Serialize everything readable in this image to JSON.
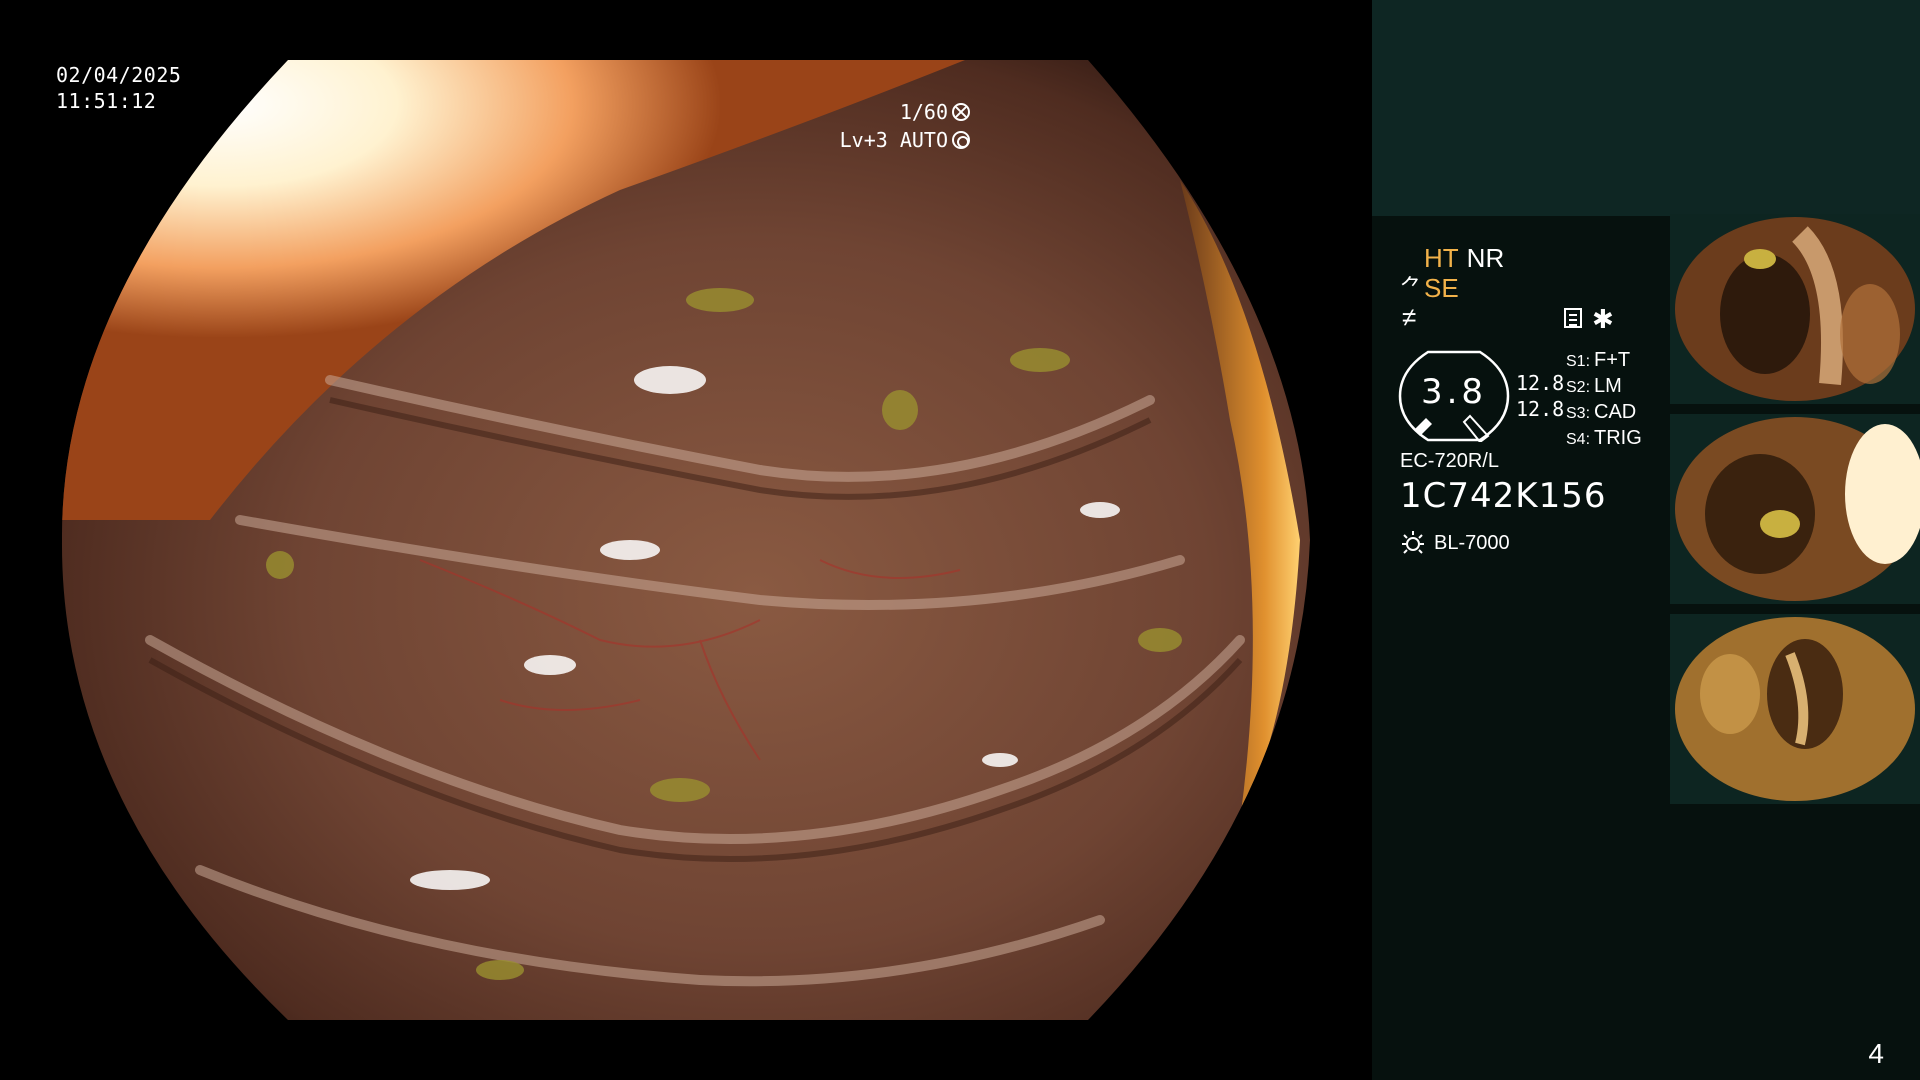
{
  "overlay": {
    "date": "02/04/2025",
    "time": "11:51:12",
    "shutter": "1/60",
    "iris": "Lv+3 AUTO"
  },
  "panel": {
    "ht": "HT",
    "nr": "NR",
    "se": "SE",
    "gauge_value": "3.8",
    "gauge_side_top": "12.8",
    "gauge_side_bottom": "12.8",
    "switches": [
      {
        "key": "S1:",
        "value": "F+T"
      },
      {
        "key": "S2:",
        "value": "LM"
      },
      {
        "key": "S3:",
        "value": "CAD"
      },
      {
        "key": "S4:",
        "value": "TRIG"
      }
    ],
    "scope_model": "EC-720R/L",
    "scope_serial": "1C742K156",
    "light_source": "BL-7000",
    "page_number": "4",
    "accent_color": "#f2b24a"
  }
}
